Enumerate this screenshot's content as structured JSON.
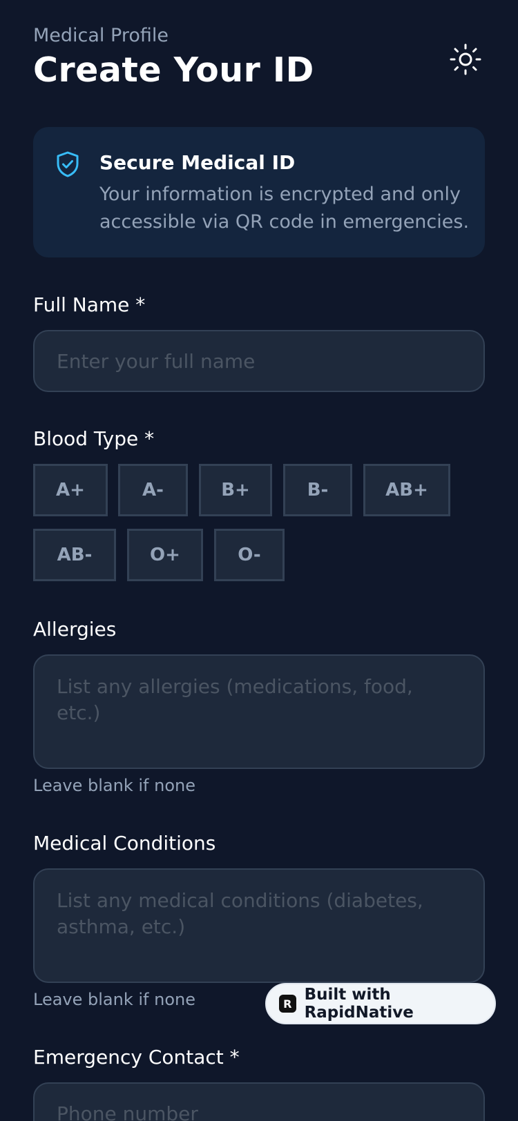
{
  "header": {
    "eyebrow": "Medical Profile",
    "title": "Create Your ID",
    "theme_icon": "sun-icon"
  },
  "info_card": {
    "icon": "shield-check-icon",
    "title": "Secure Medical ID",
    "description": "Your information is encrypted and only accessible via QR code in emergencies."
  },
  "full_name": {
    "label": "Full Name *",
    "placeholder": "Enter your full name",
    "value": ""
  },
  "blood_type": {
    "label": "Blood Type *",
    "options": [
      "A+",
      "A-",
      "B+",
      "B-",
      "AB+",
      "AB-",
      "O+",
      "O-"
    ],
    "selected": null
  },
  "allergies": {
    "label": "Allergies",
    "placeholder": "List any allergies (medications, food, etc.)",
    "hint": "Leave blank if none",
    "value": ""
  },
  "conditions": {
    "label": "Medical Conditions",
    "placeholder": "List any medical conditions (diabetes, asthma, etc.)",
    "hint": "Leave blank if none",
    "value": ""
  },
  "emergency_contact": {
    "label": "Emergency Contact *",
    "placeholder": "Phone number",
    "value": ""
  },
  "badge": {
    "logo_letter": "R",
    "text": "Built with RapidNative"
  },
  "colors": {
    "background": "#0f172a",
    "card": "#14253e",
    "input_bg": "#1e293b",
    "border": "#334155",
    "muted": "#94a3b8",
    "accent": "#38bdf8"
  }
}
